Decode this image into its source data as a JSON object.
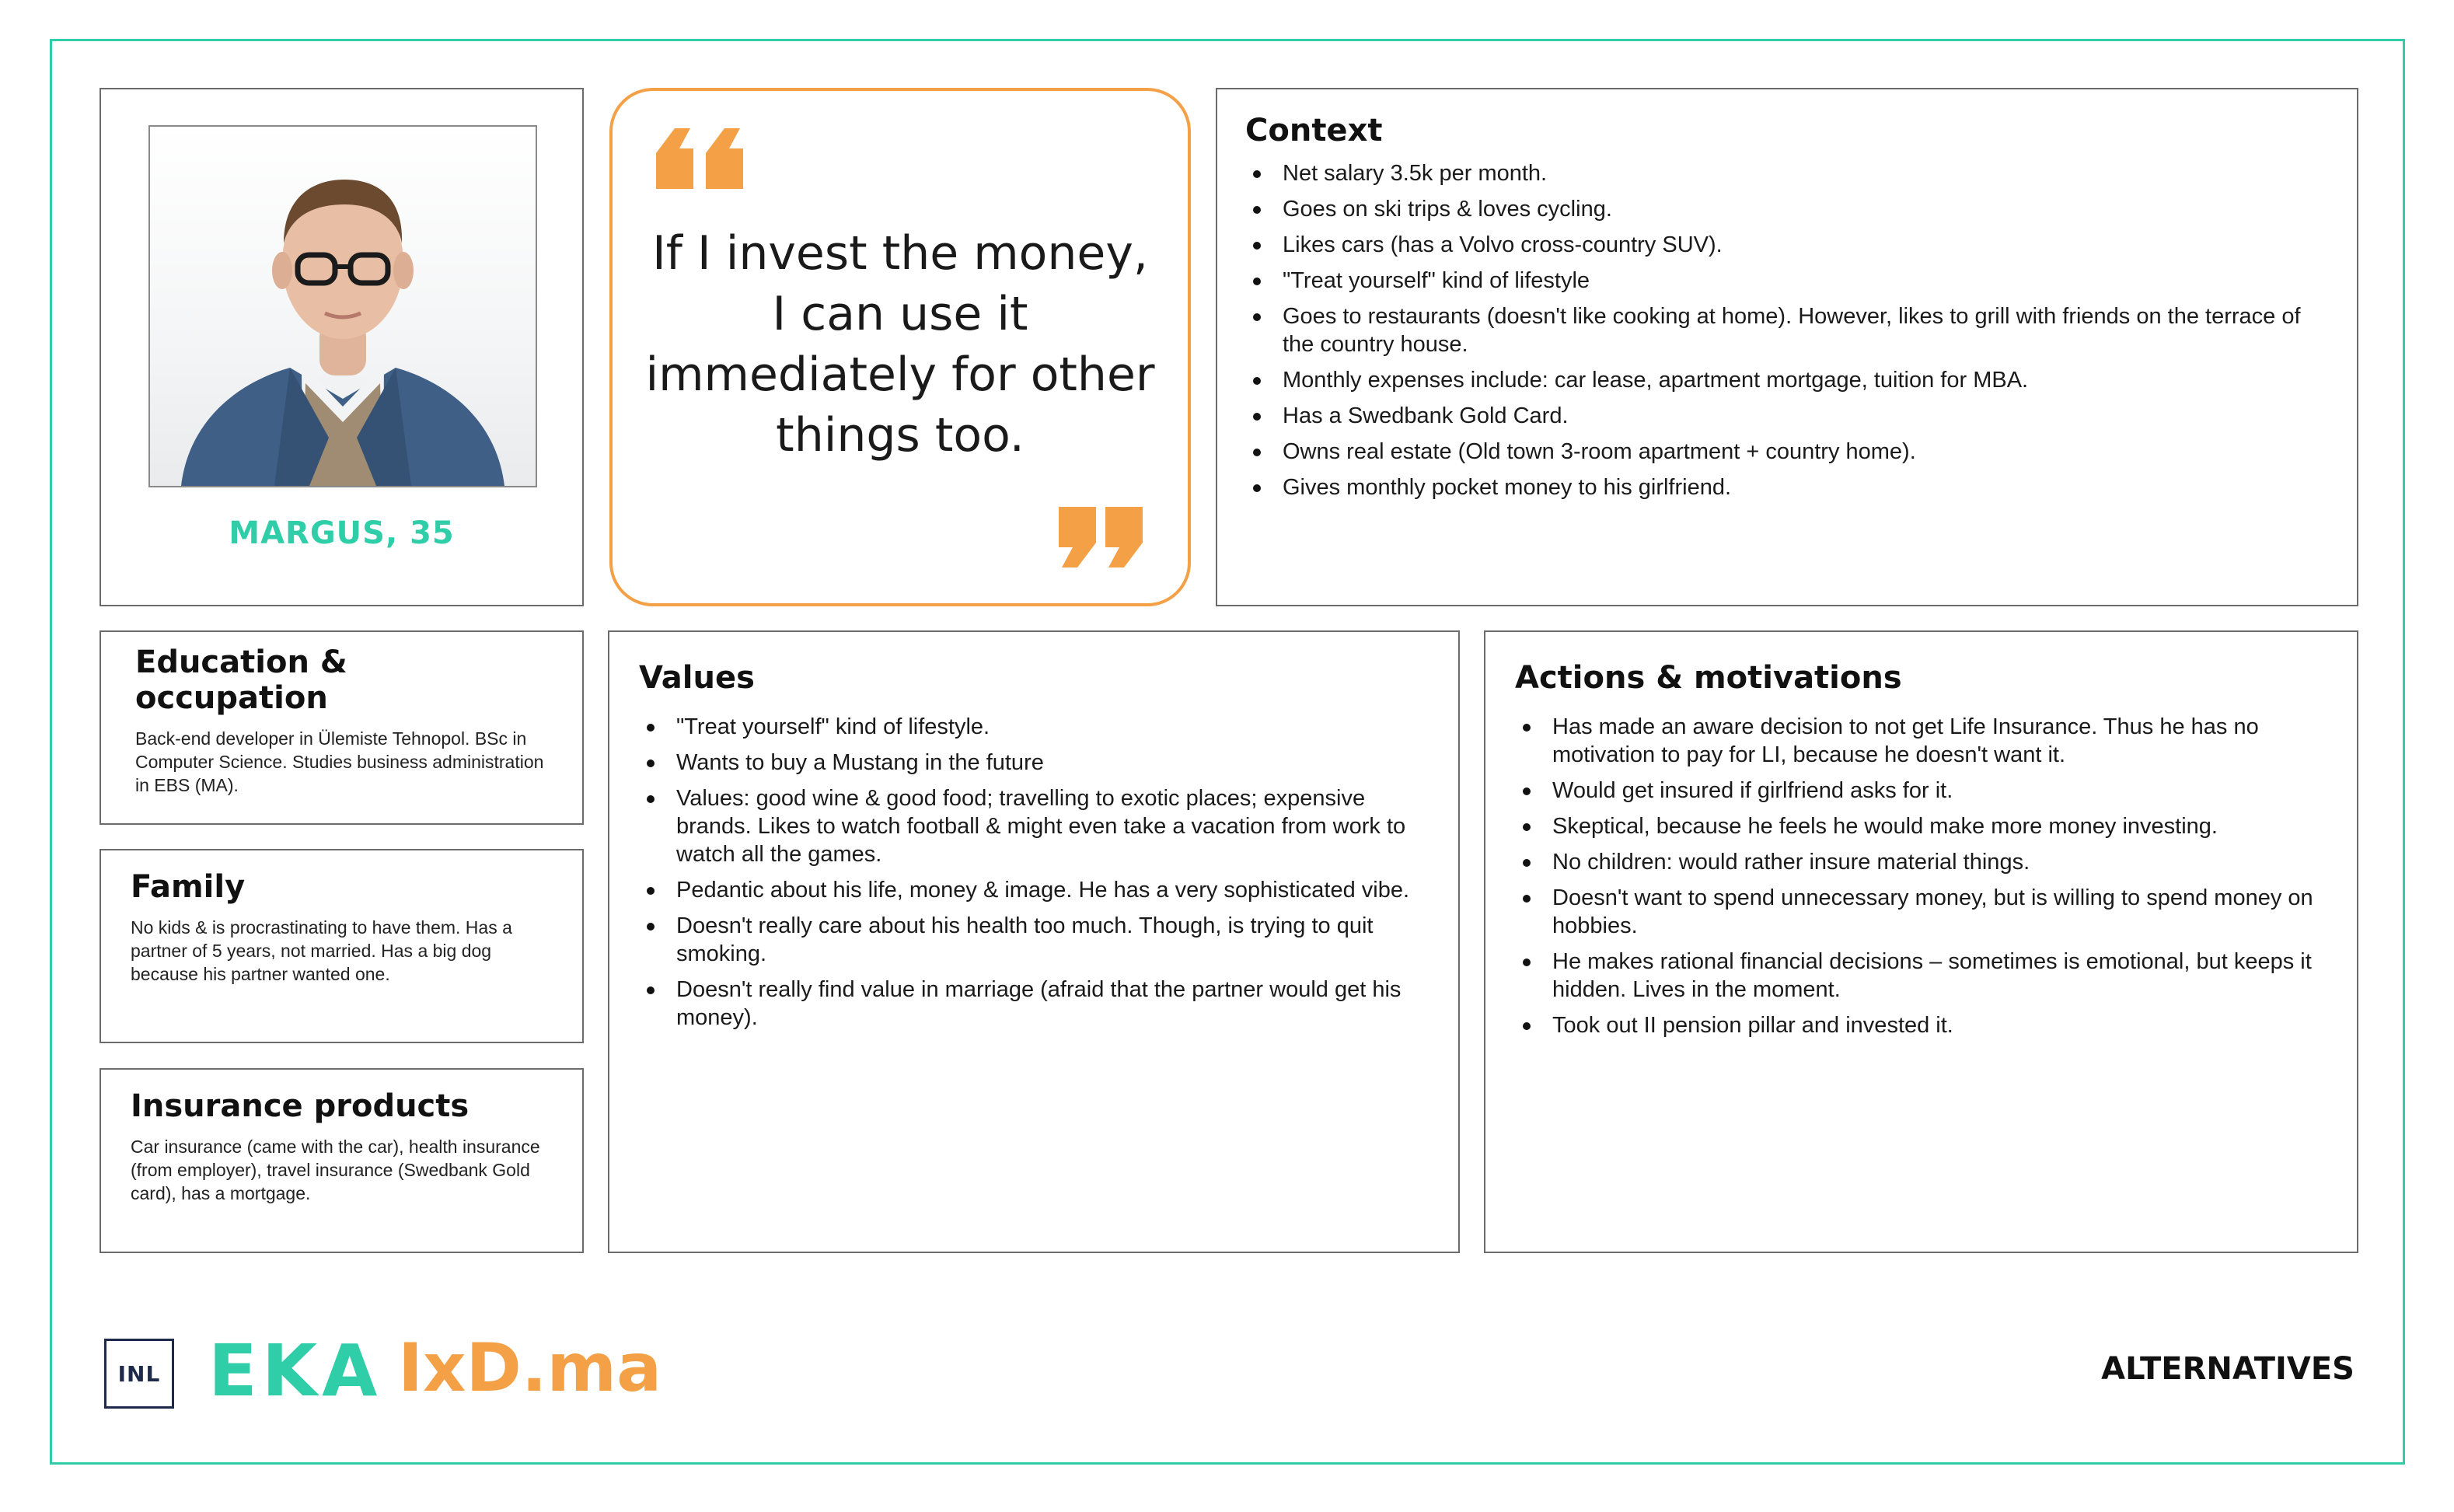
{
  "persona": {
    "name": "MARGUS, 35"
  },
  "quote": {
    "text": "If I invest the money, I can use it immediately for other things too."
  },
  "context": {
    "title": "Context",
    "items": [
      "Net salary 3.5k per month.",
      "Goes on ski trips & loves cycling.",
      "Likes cars (has a Volvo cross-country SUV).",
      "\"Treat yourself\" kind of lifestyle",
      "Goes to restaurants (doesn't like cooking at home). However, likes to grill with friends on the terrace of the country house.",
      "Monthly expenses include: car lease, apartment mortgage, tuition for MBA.",
      "Has a Swedbank Gold Card.",
      "Owns real estate (Old town 3-room apartment + country home).",
      "Gives monthly pocket money to his girlfriend."
    ]
  },
  "education": {
    "title": "Education & occupation",
    "text": "Back-end developer in Ülemiste Tehnopol. BSc in Computer Science. Studies business administration in EBS (MA)."
  },
  "family": {
    "title": "Family",
    "text": "No kids & is procrastinating to have them. Has a partner of 5 years, not married. Has a big dog because his partner wanted one."
  },
  "insurance": {
    "title": "Insurance products",
    "text": "Car insurance (came with the car), health insurance (from employer), travel insurance (Swedbank Gold card), has a mortgage."
  },
  "values": {
    "title": "Values",
    "items": [
      "\"Treat yourself\" kind of lifestyle.",
      "Wants to buy a Mustang in the future",
      "Values: good wine & good food; travelling to exotic places; expensive brands. Likes to watch football & might even take a vacation from work to watch all the games.",
      "Pedantic about his life, money & image. He has a very sophisticated vibe.",
      "Doesn't really care about his health too much. Though, is trying to quit smoking.",
      "Doesn't really find value in marriage (afraid that the partner would get his money)."
    ]
  },
  "actions": {
    "title": "Actions & motivations",
    "items": [
      "Has made an aware decision to not get Life Insurance. Thus he has no motivation to pay for LI, because he doesn't want it.",
      "Would get insured if girlfriend asks for it.",
      "Skeptical, because he feels he would make more money investing.",
      "No children: would rather insure material things.",
      "Doesn't want to spend unnecessary money, but is willing to spend money on hobbies.",
      "He makes rational financial decisions – sometimes is emotional, but keeps it hidden. Lives in the moment.",
      "Took out II pension pillar and invested it."
    ]
  },
  "footer": {
    "logo_inl": "INL",
    "logo_eka": "EKA",
    "logo_ixd": "IxD.ma",
    "tag": "ALTERNATIVES"
  },
  "colors": {
    "accent_green": "#2fcea9",
    "accent_orange": "#f3a046",
    "border_gray": "#6b6b6b",
    "navy": "#1e2a4a"
  }
}
